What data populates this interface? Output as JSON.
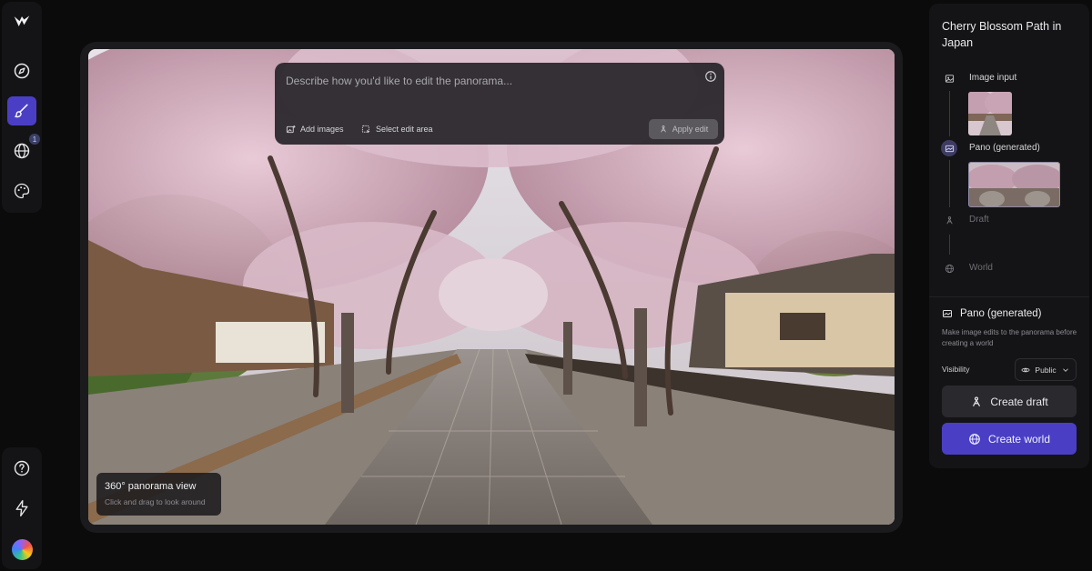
{
  "sidebar": {
    "logo": "brand-logo",
    "items": [
      {
        "icon": "compass-icon",
        "active": false
      },
      {
        "icon": "brush-icon",
        "active": true
      },
      {
        "icon": "globe-icon",
        "active": false,
        "badge": "1"
      },
      {
        "icon": "palette-icon",
        "active": false
      }
    ],
    "bottom_items": [
      {
        "icon": "help-icon"
      },
      {
        "icon": "lightning-icon"
      },
      {
        "icon": "user-avatar"
      }
    ]
  },
  "editor": {
    "prompt_placeholder": "Describe how you'd like to edit the panorama...",
    "prompt_value": "",
    "add_images_label": "Add images",
    "select_area_label": "Select edit area",
    "apply_label": "Apply edit"
  },
  "viewer_hint": {
    "title": "360° panorama view",
    "subtitle": "Click and drag to look around"
  },
  "panel": {
    "title": "Cherry Blossom Path in Japan",
    "steps": [
      {
        "label": "Image input",
        "icon": "image-icon",
        "state": "done"
      },
      {
        "label": "Pano (generated)",
        "icon": "pano-icon",
        "state": "current"
      },
      {
        "label": "Draft",
        "icon": "draft-icon",
        "state": "pending"
      },
      {
        "label": "World",
        "icon": "globe-icon",
        "state": "pending"
      }
    ],
    "section_title": "Pano (generated)",
    "section_desc": "Make image edits to the panorama before creating a world",
    "visibility_label": "Visibility",
    "visibility_value": "Public",
    "create_draft_label": "Create draft",
    "create_world_label": "Create world"
  },
  "colors": {
    "accent": "#4a3fc4",
    "background": "#0b0b0c",
    "panel": "#141416"
  }
}
